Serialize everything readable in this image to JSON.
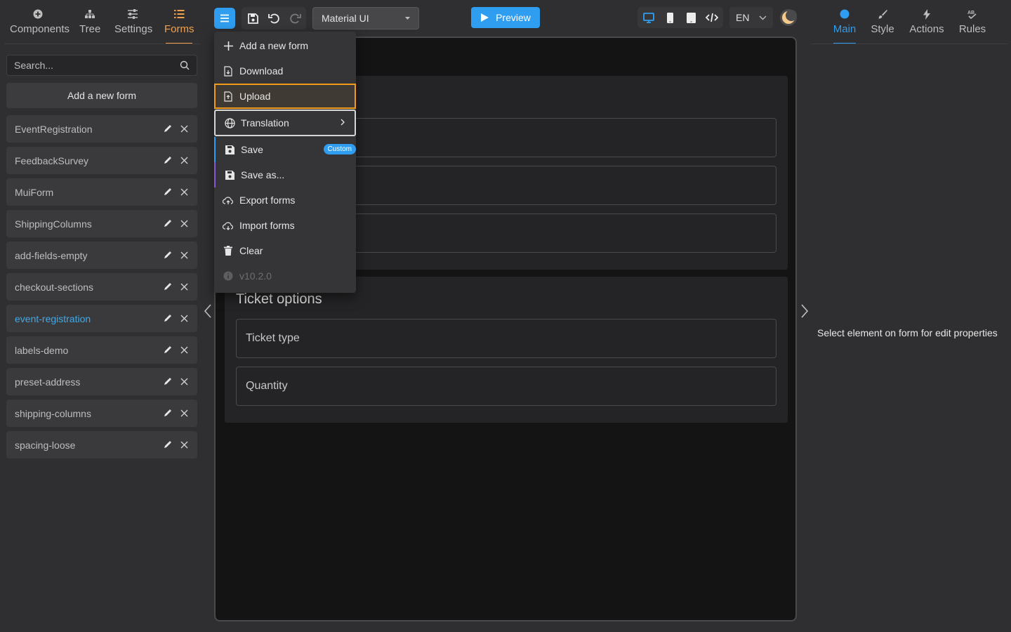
{
  "left_panel": {
    "tabs": [
      {
        "label": "Components",
        "icon": "plus-circle-icon"
      },
      {
        "label": "Tree",
        "icon": "tree-icon"
      },
      {
        "label": "Settings",
        "icon": "sliders-icon"
      },
      {
        "label": "Forms",
        "icon": "list-icon",
        "active": true
      }
    ],
    "search_placeholder": "Search...",
    "add_form_label": "Add a new form",
    "forms": [
      {
        "name": "EventRegistration"
      },
      {
        "name": "FeedbackSurvey"
      },
      {
        "name": "MuiForm"
      },
      {
        "name": "ShippingColumns"
      },
      {
        "name": "add-fields-empty"
      },
      {
        "name": "checkout-sections"
      },
      {
        "name": "event-registration",
        "selected": true
      },
      {
        "name": "labels-demo"
      },
      {
        "name": "preset-address"
      },
      {
        "name": "shipping-columns"
      },
      {
        "name": "spacing-loose"
      }
    ]
  },
  "toolbar": {
    "component_library": "Material UI",
    "preview_label": "Preview",
    "language": "EN"
  },
  "menu": {
    "items": {
      "add_new_form": "Add a new form",
      "download": "Download",
      "upload": "Upload",
      "translation": "Translation",
      "save": "Save",
      "save_badge": "Custom",
      "save_as": "Save as...",
      "export_forms": "Export forms",
      "import_forms": "Import forms",
      "clear": "Clear",
      "version": "v10.2.0"
    }
  },
  "canvas": {
    "section2_title": "Ticket options",
    "fields": {
      "ticket_type": "Ticket type",
      "quantity": "Quantity"
    }
  },
  "right_panel": {
    "tabs": [
      {
        "label": "Main",
        "active": true
      },
      {
        "label": "Style"
      },
      {
        "label": "Actions"
      },
      {
        "label": "Rules"
      }
    ],
    "empty_message": "Select element on form for edit properties"
  },
  "colors": {
    "accent_blue": "#2f9ef0",
    "accent_orange": "#f0a04b",
    "background": "#2f2f31",
    "canvas": "#141414"
  }
}
